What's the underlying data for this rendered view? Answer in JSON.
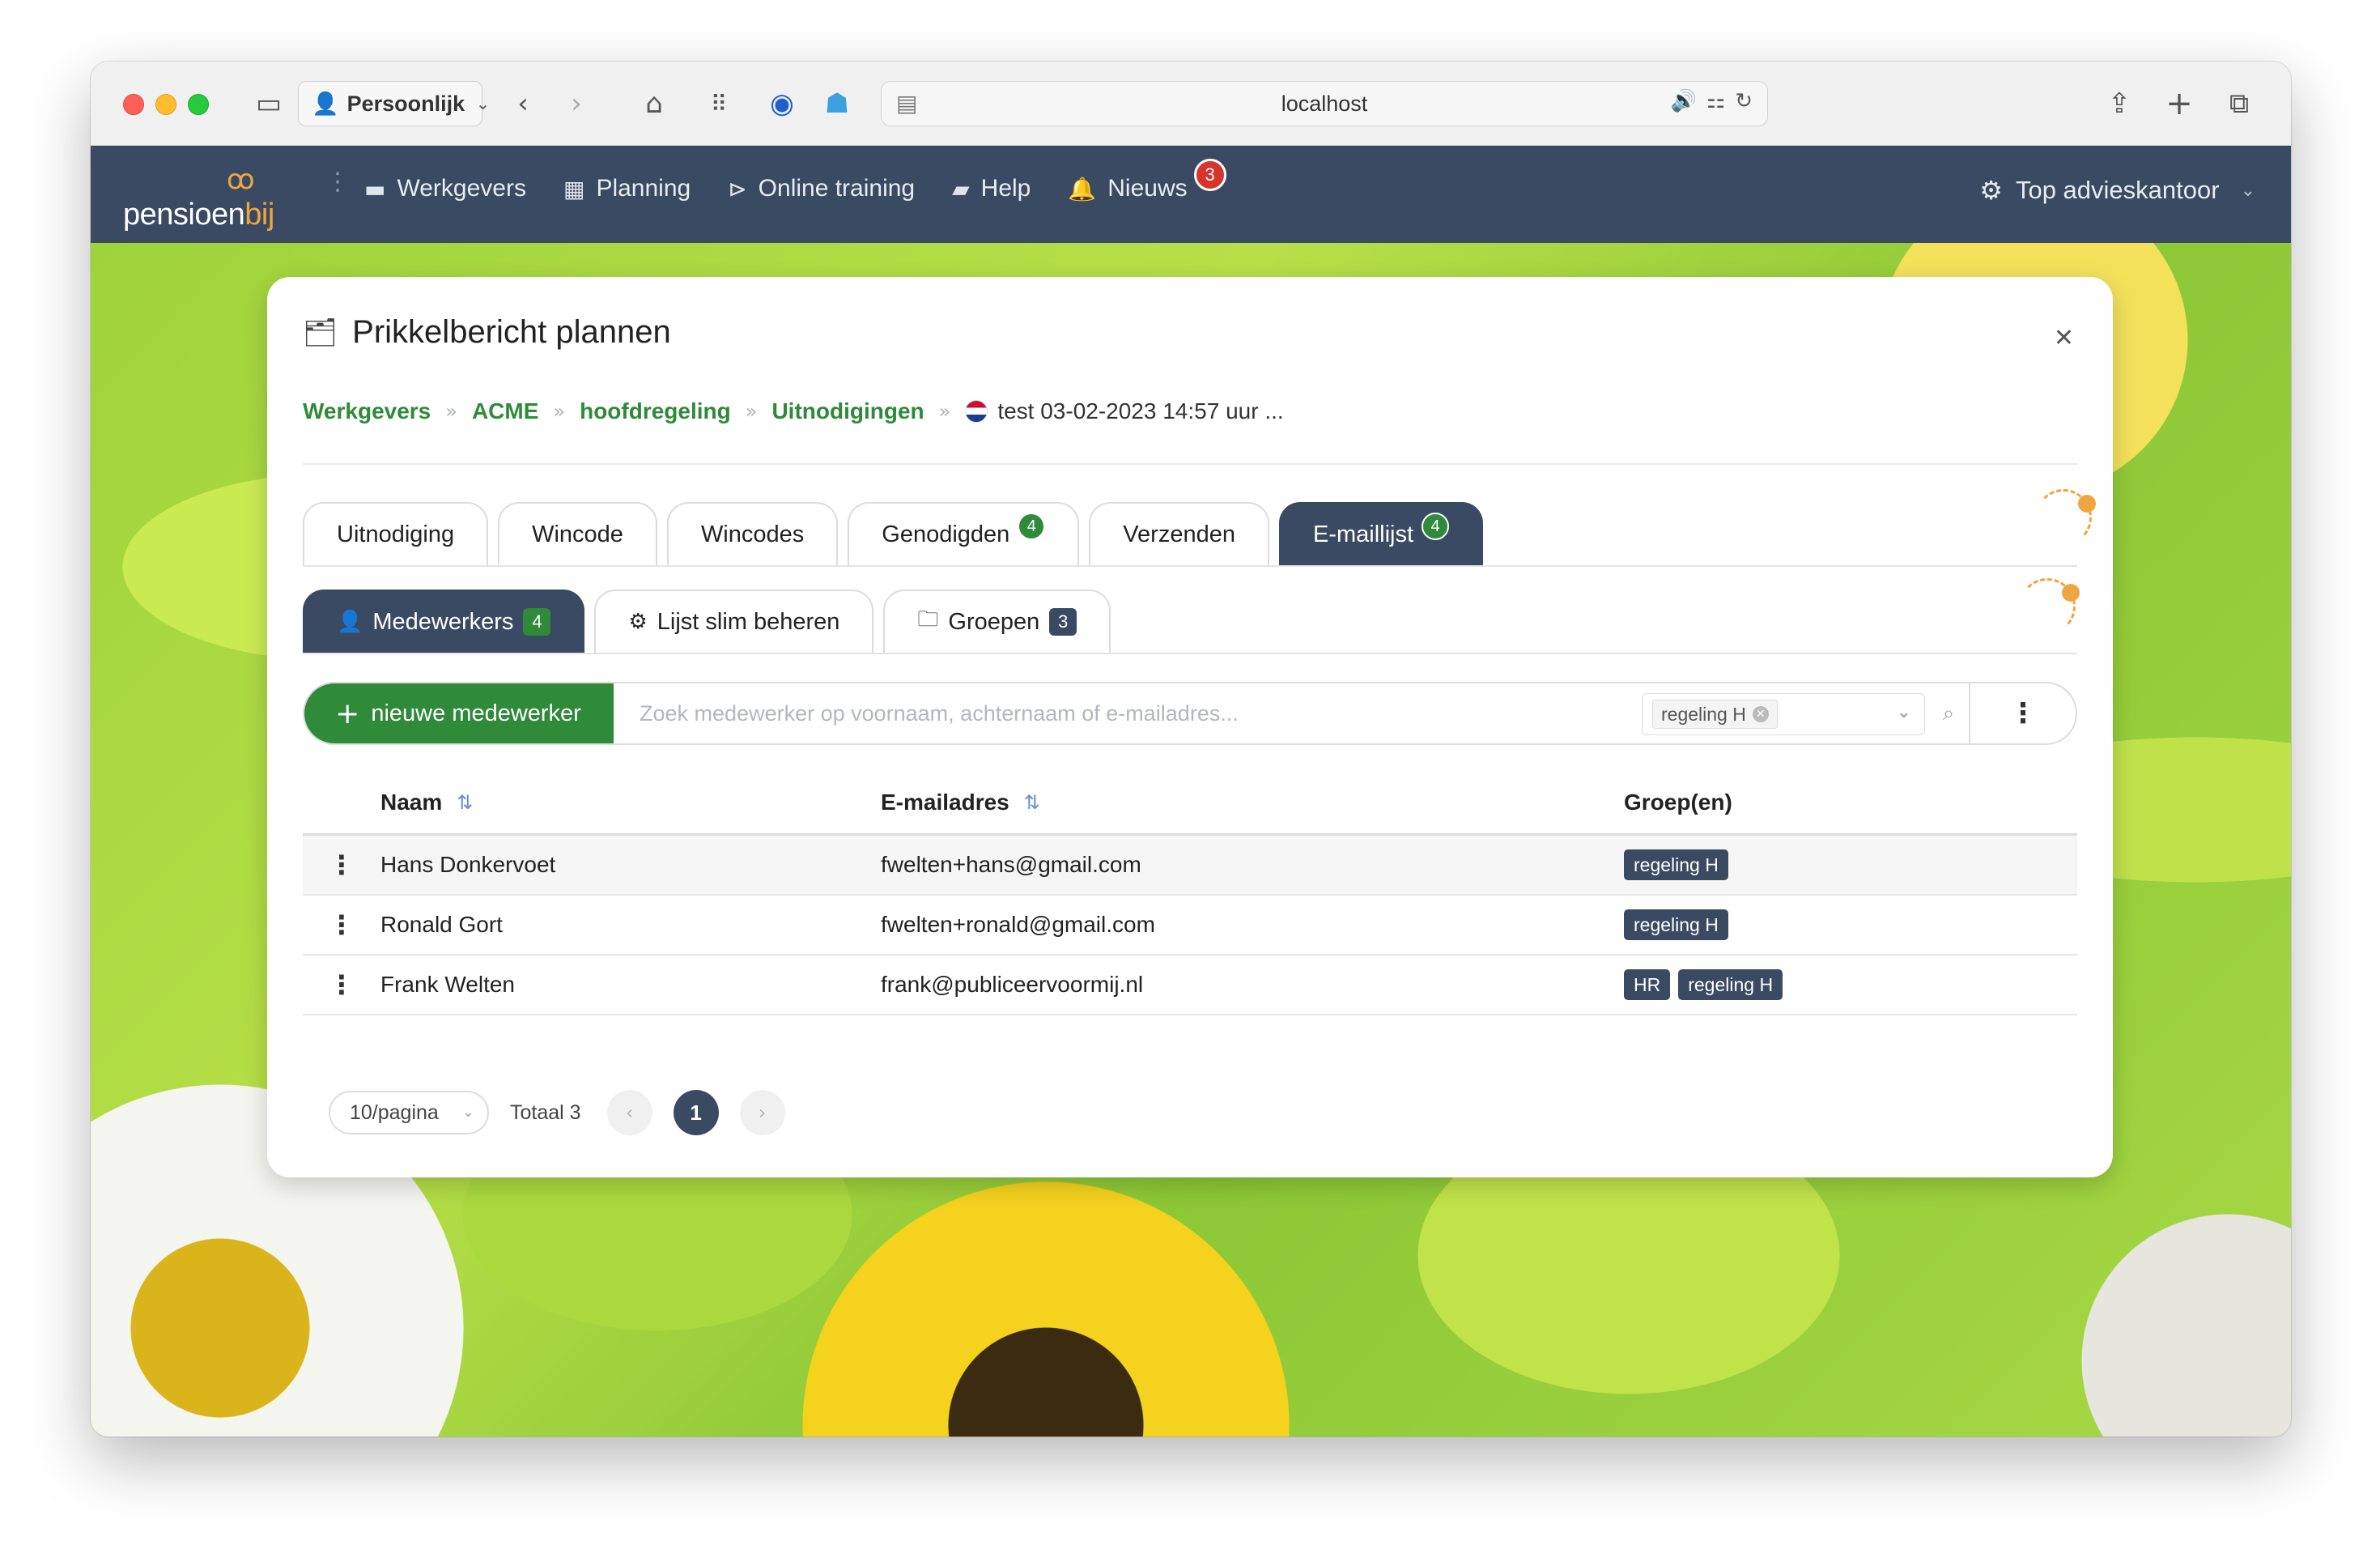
{
  "browser": {
    "profile": "Persoonlijk",
    "url": "localhost"
  },
  "app": {
    "logo_text": "pensioen",
    "logo_accent": "bij",
    "nav": [
      {
        "label": "Werkgevers",
        "icon": "briefcase-icon"
      },
      {
        "label": "Planning",
        "icon": "calendar-icon"
      },
      {
        "label": "Online training",
        "icon": "play-circle-icon"
      },
      {
        "label": "Help",
        "icon": "book-icon"
      },
      {
        "label": "Nieuws",
        "icon": "bell-icon",
        "badge": "3"
      }
    ],
    "account": "Top advieskantoor"
  },
  "modal": {
    "title": "Prikkelbericht plannen",
    "breadcrumb": [
      "Werkgevers",
      "ACME",
      "hoofdregeling",
      "Uitnodigingen"
    ],
    "breadcrumb_current": "test 03-02-2023 14:57 uur ...",
    "tabs": [
      {
        "label": "Uitnodiging"
      },
      {
        "label": "Wincode"
      },
      {
        "label": "Wincodes"
      },
      {
        "label": "Genodigden",
        "count": "4"
      },
      {
        "label": "Verzenden"
      },
      {
        "label": "E-maillijst",
        "count": "4",
        "active": true
      }
    ],
    "subtabs": [
      {
        "label": "Medewerkers",
        "count": "4",
        "active": true
      },
      {
        "label": "Lijst slim beheren"
      },
      {
        "label": "Groepen",
        "count": "3"
      }
    ],
    "toolbar": {
      "new_button": "nieuwe medewerker",
      "search_placeholder": "Zoek medewerker op voornaam, achternaam of e-mailadres...",
      "group_filter": "regeling H"
    },
    "table": {
      "columns": [
        "Naam",
        "E-mailadres",
        "Groep(en)"
      ],
      "rows": [
        {
          "name": "Hans Donkervoet",
          "email": "fwelten+hans@gmail.com",
          "groups": [
            "regeling H"
          ]
        },
        {
          "name": "Ronald Gort",
          "email": "fwelten+ronald@gmail.com",
          "groups": [
            "regeling H"
          ]
        },
        {
          "name": "Frank Welten",
          "email": "frank@publiceervoormij.nl",
          "groups": [
            "HR",
            "regeling H"
          ]
        }
      ]
    },
    "pagination": {
      "per_page": "10/pagina",
      "total": "Totaal 3",
      "current_page": "1"
    }
  },
  "colors": {
    "nav_bg": "#3a4a63",
    "accent_green": "#2f8a3a",
    "badge_red": "#d9342b",
    "logo_orange": "#f0a640"
  }
}
